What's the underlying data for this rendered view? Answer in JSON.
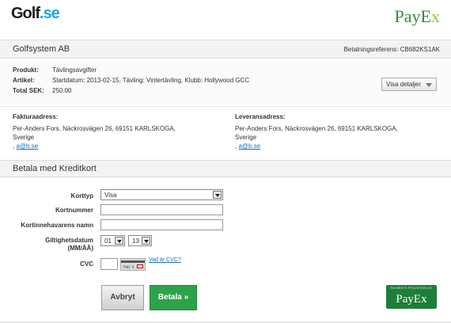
{
  "header": {
    "golf_logo_main": "Golf",
    "golf_logo_dot": ".se",
    "payex_logo_main": "PayE",
    "payex_logo_x": "x"
  },
  "merchant": {
    "company": "Golfsystem AB",
    "reference_label": "Betalningsreferens:",
    "reference_value": "CB682KS1AK"
  },
  "order": {
    "product_label": "Produkt:",
    "product_value": "Tävlingsavgifter",
    "article_label": "Artikel:",
    "article_value": "Startdatum: 2013-02-15, Tävling: Vintertävling, Klubb: Hollywood GCC",
    "total_label": "Total SEK:",
    "total_value": "250.00",
    "details_button": "Visa detaljer"
  },
  "billing": {
    "heading": "Fakturaadress:",
    "line1": "Per-Anders Fors, Näckrosvägen 26, 69151 KARLSKOGA,",
    "line2": "Sverige",
    "email_prefix": ", ",
    "email": "a@b.se"
  },
  "delivery": {
    "heading": "Leveransadress:",
    "line1": "Per-Anders Fors, Näckrosvägen 26, 69151 KARLSKOGA,",
    "line2": "Sverige",
    "email_prefix": ", ",
    "email": "a@b.se"
  },
  "payment": {
    "section_title": "Betala med Kreditkort",
    "card_type_label": "Korttyp",
    "card_type_value": "Visa",
    "card_number_label": "Kortnummer",
    "card_number_value": "",
    "cardholder_label": "Kortinnehavarens namn",
    "cardholder_value": "",
    "expiry_label_line1": "Giltighetsdatum",
    "expiry_label_line2": "(MM/ÅÅ)",
    "expiry_month": "01",
    "expiry_year": "13",
    "cvc_label": "CVC",
    "cvc_value": "",
    "cvc_card_digits": "7982 9 123",
    "cvc_help_link": "Vad är CVC?",
    "cancel_button": "Avbryt",
    "pay_button": "Betala »"
  },
  "footer_badge": {
    "small_text": "PAYMENTS PROCESSED BY",
    "brand": "PayEx"
  },
  "colors": {
    "payex_green": "#3a8a3a",
    "pay_button_green": "#2ea24a",
    "link_blue": "#1a6fb5"
  }
}
